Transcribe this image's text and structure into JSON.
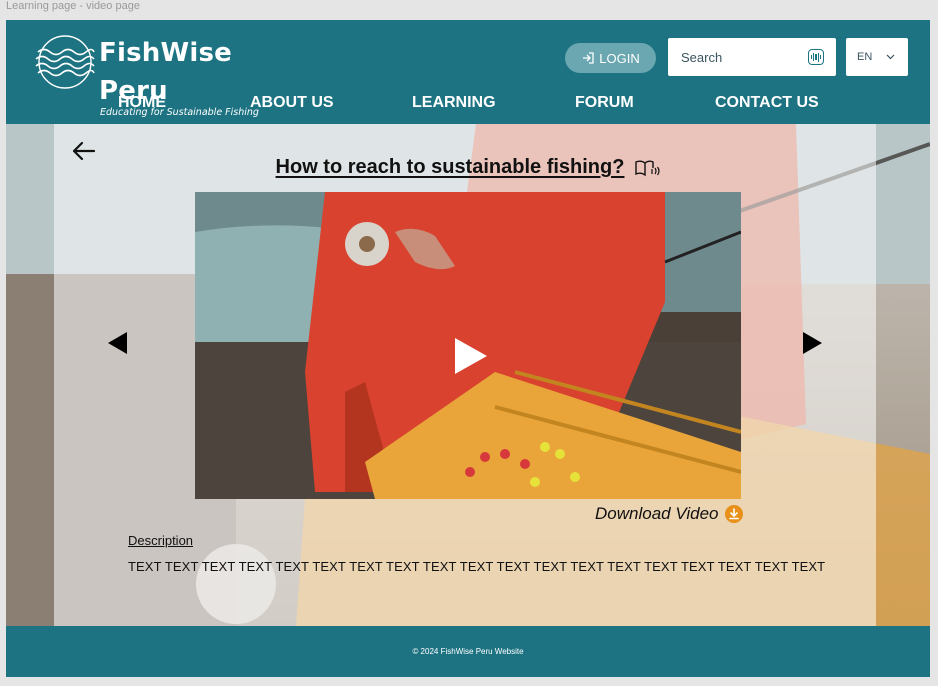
{
  "frame_label": "Learning page - video page",
  "header": {
    "brand": "FishWise Peru",
    "tagline": "Educating for Sustainable Fishing",
    "login_label": "LOGIN",
    "search_placeholder": "Search",
    "language": "EN"
  },
  "nav": [
    {
      "label": "HOME"
    },
    {
      "label": "ABOUT US"
    },
    {
      "label": "LEARNING"
    },
    {
      "label": "FORUM"
    },
    {
      "label": "CONTACT US"
    }
  ],
  "content": {
    "title": "How to reach to sustainable fishing?",
    "download_label": "Download Video",
    "description_label": "Description",
    "description_text": "TEXT TEXT TEXT TEXT TEXT TEXT TEXT TEXT TEXT TEXT TEXT TEXT TEXT TEXT TEXT TEXT TEXT TEXT TEXT"
  },
  "footer": {
    "copyright": "© 2024 FishWise Peru Website"
  },
  "colors": {
    "brand": "#1d7382",
    "login_button": "#6aa7b0",
    "download_accent": "#e8901a"
  },
  "icons": [
    "waves-logo-icon",
    "login-icon",
    "voice-search-icon",
    "chevron-down-icon",
    "back-arrow-icon",
    "audio-book-icon",
    "play-icon",
    "download-icon"
  ]
}
